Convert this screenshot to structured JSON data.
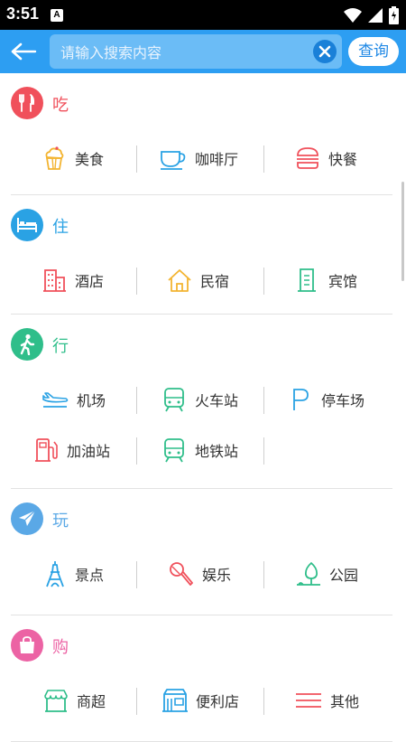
{
  "status": {
    "time": "3:51",
    "notif": "A"
  },
  "search": {
    "placeholder": "请输入搜索内容",
    "query_label": "查询"
  },
  "colors": {
    "accent": "#2d9ef2",
    "eat": "#f0505b",
    "stay": "#2aa2e4",
    "go": "#2fbe8a",
    "play": "#5aa8e6",
    "shop": "#ec63a4"
  },
  "sections": [
    {
      "title": "吃",
      "icon": "fork-knife-icon",
      "items": [
        "美食",
        "咖啡厅",
        "快餐"
      ]
    },
    {
      "title": "住",
      "icon": "bed-icon",
      "items": [
        "酒店",
        "民宿",
        "宾馆"
      ]
    },
    {
      "title": "行",
      "icon": "walking-person-icon",
      "items": [
        "机场",
        "火车站",
        "停车场",
        "加油站",
        "地铁站"
      ]
    },
    {
      "title": "玩",
      "icon": "paper-plane-icon",
      "items": [
        "景点",
        "娱乐",
        "公园"
      ]
    },
    {
      "title": "购",
      "icon": "shopping-bag-icon",
      "items": [
        "商超",
        "便利店",
        "其他"
      ]
    }
  ]
}
